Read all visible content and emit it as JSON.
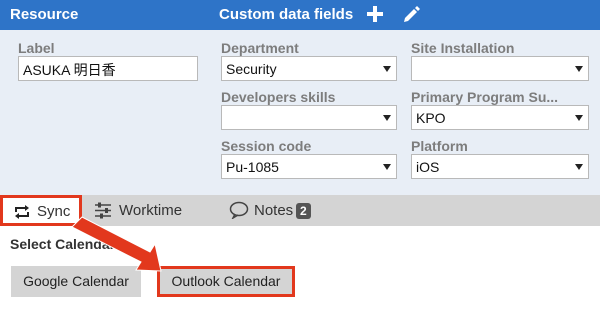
{
  "header": {
    "resource_title": "Resource",
    "custom_fields_title": "Custom data fields",
    "add_icon": "plus-icon",
    "edit_icon": "pencil-icon"
  },
  "fields": {
    "label": {
      "label": "Label",
      "value": "ASUKA  明日香"
    },
    "department": {
      "label": "Department",
      "value": "Security"
    },
    "site_installation": {
      "label": "Site Installation",
      "value": ""
    },
    "developers_skills": {
      "label": "Developers skills",
      "value": ""
    },
    "primary_program": {
      "label": "Primary Program Su...",
      "value": "KPO"
    },
    "session_code": {
      "label": "Session code",
      "value": "Pu-1085"
    },
    "platform": {
      "label": "Platform",
      "value": "iOS"
    }
  },
  "tabs": {
    "sync": "Sync",
    "worktime": "Worktime",
    "notes": "Notes",
    "notes_count": "2"
  },
  "calendar": {
    "label": "Select Calendar",
    "google": "Google Calendar",
    "outlook": "Outlook Calendar"
  },
  "colors": {
    "header_bg": "#2e74c8",
    "panel_bg": "#e8eef6",
    "tabbar_bg": "#d4d4d4",
    "annotation_red": "#e2381d"
  }
}
